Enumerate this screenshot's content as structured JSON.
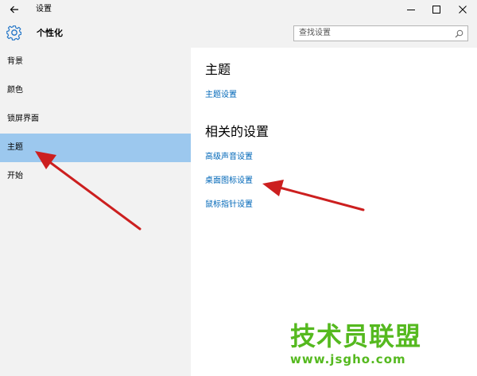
{
  "window": {
    "title": "设置",
    "back_icon": "back-arrow-icon",
    "controls": [
      "minimize-icon",
      "maximize-icon",
      "close-icon"
    ]
  },
  "header": {
    "icon": "gear-icon",
    "title": "个性化"
  },
  "search": {
    "placeholder": "查找设置",
    "value": "",
    "icon": "search-icon"
  },
  "sidebar": {
    "items": [
      {
        "label": "背景",
        "selected": false
      },
      {
        "label": "颜色",
        "selected": false
      },
      {
        "label": "锁屏界面",
        "selected": false
      },
      {
        "label": "主题",
        "selected": true
      },
      {
        "label": "开始",
        "selected": false
      }
    ]
  },
  "content": {
    "section1": {
      "heading": "主题",
      "links": [
        "主题设置"
      ]
    },
    "section2": {
      "heading": "相关的设置",
      "links": [
        "高级声音设置",
        "桌面图标设置",
        "鼠标指针设置"
      ]
    }
  },
  "watermark": {
    "text": "技术员联盟",
    "url": "www.jsgho.com"
  },
  "colors": {
    "accent_link": "#0067b8",
    "selected_item": "#9cc8ee",
    "sidebar_bg": "#f2f2f2",
    "annotation_arrow": "#cc1f1f",
    "watermark": "#55b91f"
  }
}
